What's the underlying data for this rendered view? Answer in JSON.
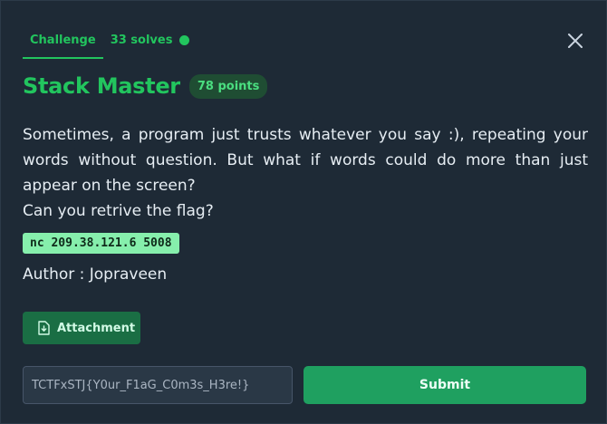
{
  "tabs": {
    "challenge_label": "Challenge",
    "solves_label": "33 solves"
  },
  "challenge": {
    "title": "Stack Master",
    "points": "78 points",
    "description_line1": "Sometimes, a program just trusts whatever you say :), repeating your words without question. But what if words could do more than just appear on the screen?",
    "description_line2": "Can you retrive the flag?",
    "connection": "nc 209.38.121.6 5008",
    "author": "Author : Jopraveen"
  },
  "attachment": {
    "label": "Attachment"
  },
  "flag": {
    "placeholder": "TCTFxSTJ{Y0ur_F1aG_C0m3s_H3re!}",
    "value": ""
  },
  "submit": {
    "label": "Submit"
  },
  "colors": {
    "accent": "#22c55e",
    "background": "#1e2a36",
    "code_bg": "#86efac",
    "button_bg": "#1fa060"
  },
  "icons": {
    "close": "close-icon",
    "attachment": "file-download-icon",
    "status": "status-dot-icon"
  }
}
